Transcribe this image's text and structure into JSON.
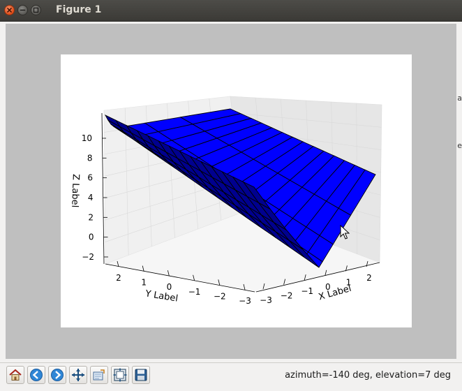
{
  "window": {
    "title": "Figure 1"
  },
  "toolbar": {
    "buttons": [
      {
        "name": "home-button",
        "icon": "home-icon"
      },
      {
        "name": "back-button",
        "icon": "back-arrow-icon"
      },
      {
        "name": "forward-button",
        "icon": "forward-arrow-icon"
      },
      {
        "name": "pan-button",
        "icon": "move-arrows-icon"
      },
      {
        "name": "zoom-button",
        "icon": "zoom-rect-icon"
      },
      {
        "name": "subplots-button",
        "icon": "subplots-icon"
      },
      {
        "name": "save-button",
        "icon": "floppy-disk-icon"
      }
    ],
    "status": "azimuth=-140 deg, elevation=7 deg"
  },
  "background_fragments": [
    "a",
    "e"
  ],
  "chart_data": {
    "type": "surface3d",
    "surface_color": "#0000ff",
    "xlabel": "X Label",
    "ylabel": "Y Label",
    "zlabel": "Z Label",
    "x_ticks": [
      "−3",
      "−2",
      "−1",
      "0",
      "1",
      "2"
    ],
    "y_ticks": [
      "2",
      "1",
      "0",
      "−1",
      "−2",
      "−3"
    ],
    "z_ticks": [
      "10",
      "8",
      "6",
      "4",
      "2",
      "0",
      "−2"
    ],
    "xlim": [
      -3,
      3
    ],
    "ylim": [
      -3,
      3
    ],
    "zlim": [
      -3,
      12
    ],
    "view": {
      "azimuth": -140,
      "elevation": 7
    }
  }
}
